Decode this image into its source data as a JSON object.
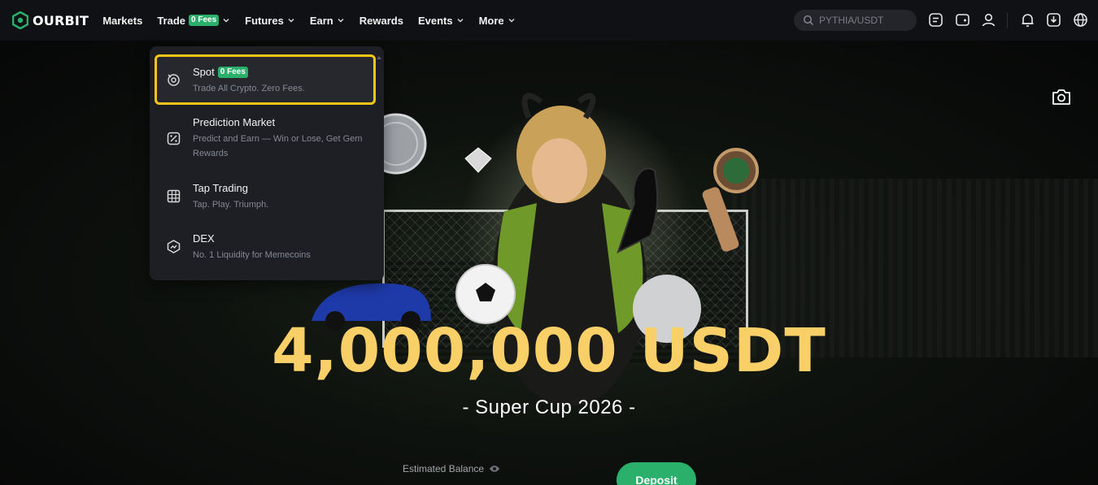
{
  "brand": {
    "name": "OURBIT",
    "color": "#2bb06b"
  },
  "nav": {
    "items": [
      {
        "label": "Markets",
        "has_dropdown": false
      },
      {
        "label": "Trade",
        "badge": "0 Fees",
        "has_dropdown": true
      },
      {
        "label": "Futures",
        "has_dropdown": true
      },
      {
        "label": "Earn",
        "has_dropdown": true
      },
      {
        "label": "Rewards",
        "has_dropdown": false
      },
      {
        "label": "Events",
        "has_dropdown": true
      },
      {
        "label": "More",
        "has_dropdown": true
      }
    ],
    "search_placeholder": "PYTHIA/USDT",
    "icons": [
      "orders-icon",
      "wallet-icon",
      "user-icon",
      "bell-icon",
      "download-icon",
      "globe-icon"
    ]
  },
  "trade_dropdown": {
    "items": [
      {
        "title": "Spot",
        "badge": "0 Fees",
        "desc": "Trade All Crypto. Zero Fees.",
        "icon": "spot-icon",
        "highlighted": true
      },
      {
        "title": "Prediction Market",
        "desc": "Predict and Earn — Win or Lose, Get Gem Rewards",
        "icon": "prediction-icon"
      },
      {
        "title": "Tap Trading",
        "desc": "Tap. Play. Triumph.",
        "icon": "grid-icon"
      },
      {
        "title": "DEX",
        "desc": "No. 1 Liquidity for Memecoins",
        "icon": "dex-icon"
      }
    ]
  },
  "hero": {
    "amount": "4,000,000 USDT",
    "subtitle": "- Super Cup 2026 -",
    "estimated_balance_label": "Estimated Balance",
    "deposit_label": "Deposit",
    "accent_color": "#f9cf67"
  }
}
